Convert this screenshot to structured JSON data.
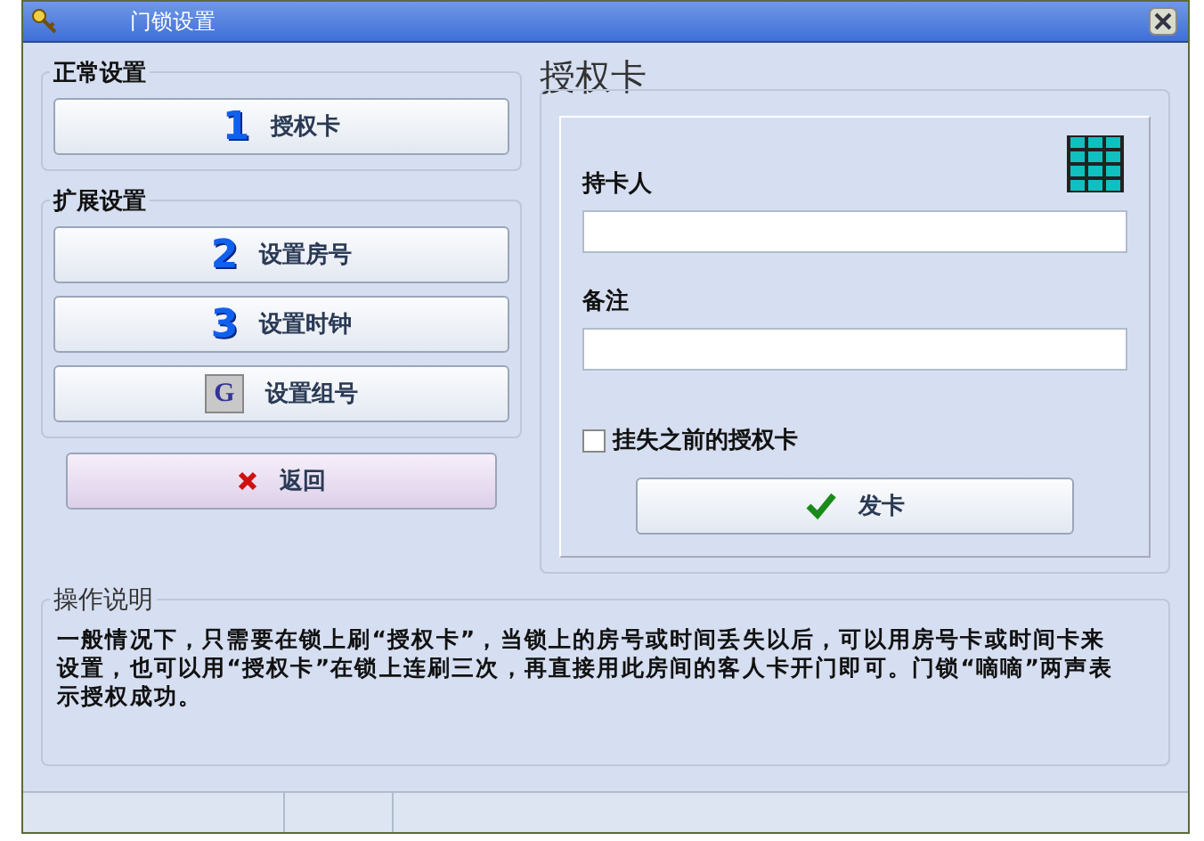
{
  "window": {
    "title": "门锁设置"
  },
  "groups": [
    {
      "title": "正常设置",
      "buttons": [
        {
          "kind": "digit",
          "badge": "1",
          "label": "授权卡"
        }
      ]
    },
    {
      "title": "扩展设置",
      "buttons": [
        {
          "kind": "digit",
          "badge": "2",
          "label": "设置房号"
        },
        {
          "kind": "digit",
          "badge": "3",
          "label": "设置时钟"
        },
        {
          "kind": "letter",
          "badge": "G",
          "label": "设置组号"
        }
      ]
    }
  ],
  "back_button": {
    "label": "返回"
  },
  "card_panel": {
    "title": "授权卡",
    "holder_label": "持卡人",
    "note_label": "备注",
    "report_lost": {
      "label": "挂失之前的授权卡",
      "checked": false
    },
    "issue_button": {
      "label": "发卡"
    }
  },
  "instructions": {
    "title": "操作说明",
    "text": "一般情况下，只需要在锁上刷“授权卡”，当锁上的房号或时间丢失以后，可以用房号卡或时间卡来设置，也可以用“授权卡”在锁上连刷三次，再直接用此房间的客人卡开门即可。门锁“嘀嘀”两声表示授权成功。"
  }
}
